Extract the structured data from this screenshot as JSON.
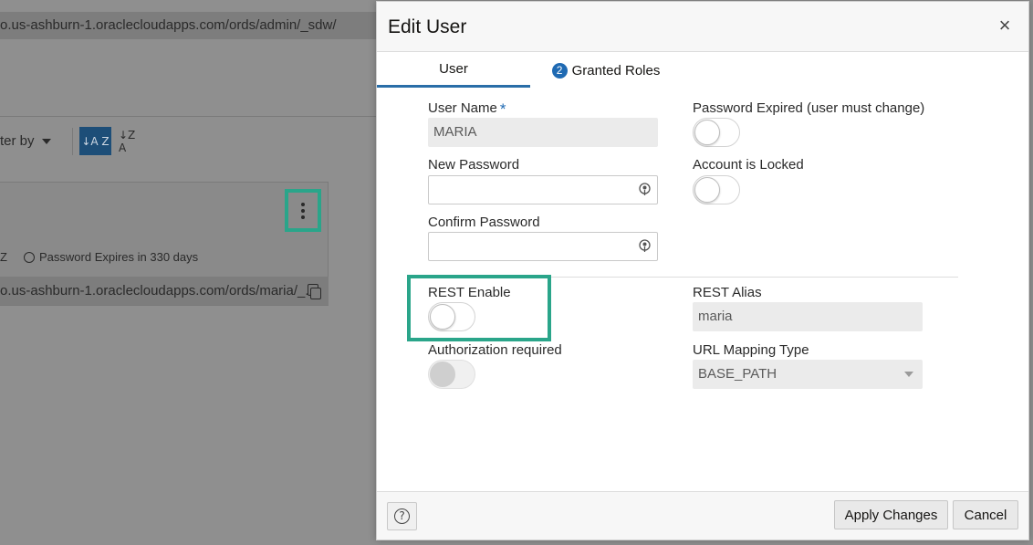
{
  "background": {
    "admin_url": "o.us-ashburn-1.oraclecloudapps.com/ords/admin/_sdw/",
    "filter_label": "ter by",
    "sort_asc_glyph": "↓A Z",
    "sort_desc_glyph": "↓Z A",
    "card": {
      "z_fragment": "Z",
      "password_expires": "Password Expires in 330 days",
      "user_url": "o.us-ashburn-1.oraclecloudapps.com/ords/maria/_..."
    }
  },
  "dialog": {
    "title": "Edit User",
    "close_glyph": "×",
    "tabs": [
      {
        "label": "User",
        "active": true
      },
      {
        "label": "Granted Roles",
        "badge": "2",
        "active": false
      }
    ],
    "fields": {
      "user_name": {
        "label": "User Name",
        "required_mark": "*",
        "value": "MARIA"
      },
      "new_password": {
        "label": "New Password",
        "value": ""
      },
      "confirm_password": {
        "label": "Confirm Password",
        "value": ""
      },
      "password_expired": {
        "label": "Password Expired (user must change)",
        "on": false
      },
      "account_locked": {
        "label": "Account is Locked",
        "on": false
      },
      "rest_enable": {
        "label": "REST Enable",
        "on": false
      },
      "authorization_required": {
        "label": "Authorization required",
        "on": false,
        "disabled": true
      },
      "rest_alias": {
        "label": "REST Alias",
        "value": "maria"
      },
      "url_mapping_type": {
        "label": "URL Mapping Type",
        "value": "BASE_PATH"
      }
    },
    "footer": {
      "help_glyph": "?",
      "apply_label": "Apply Changes",
      "cancel_label": "Cancel"
    }
  },
  "colors": {
    "accent": "#1f6ab3",
    "highlight": "#2aa58a"
  }
}
